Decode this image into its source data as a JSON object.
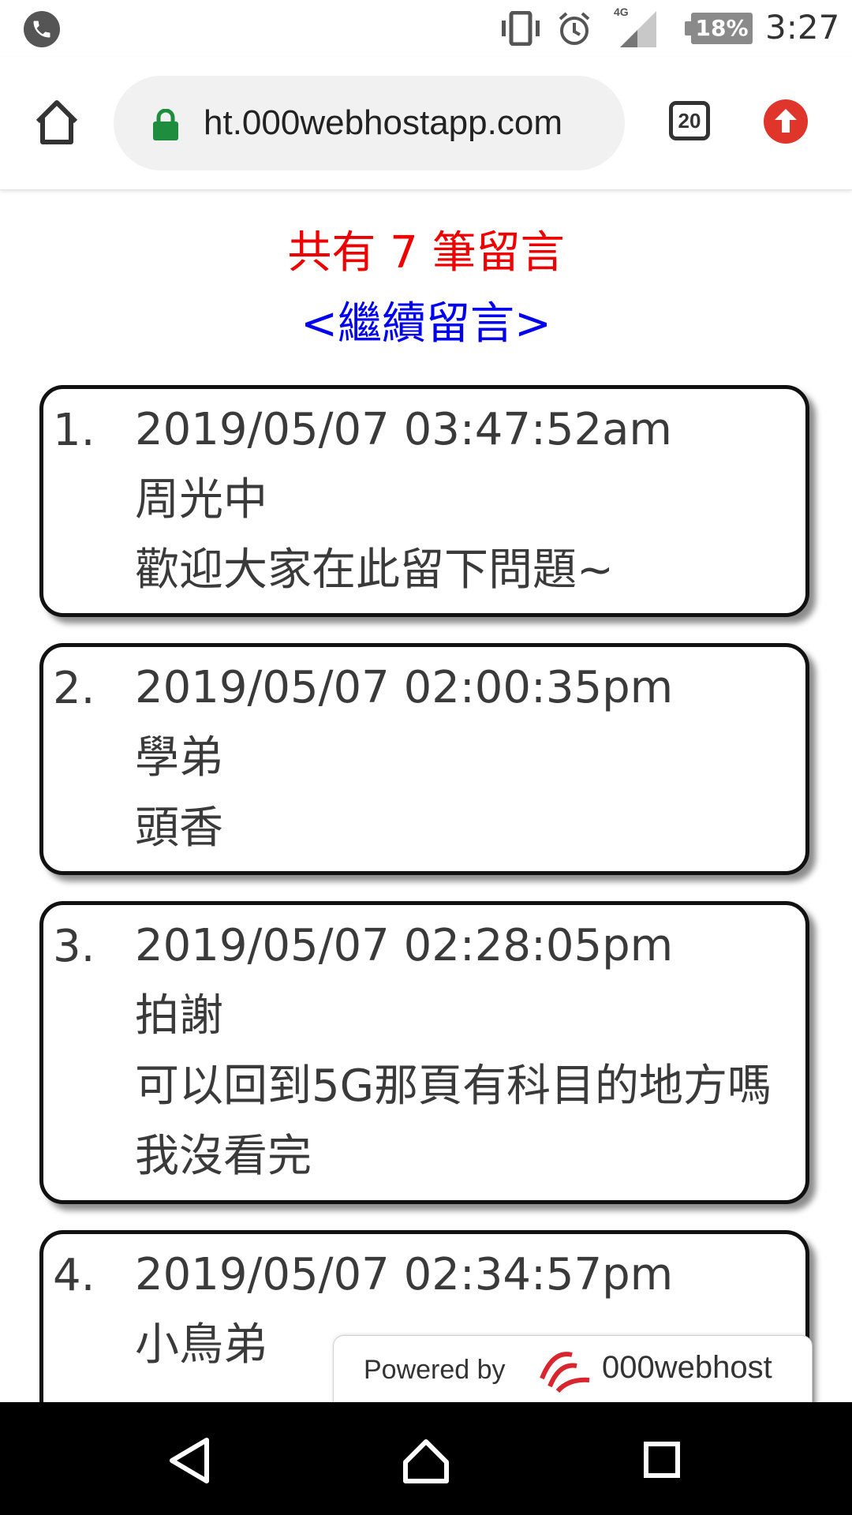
{
  "status_bar": {
    "left_icon": "phone-call-icon",
    "network": "4G",
    "battery": "18%",
    "time": "3:27"
  },
  "browser": {
    "home_icon": "home-icon",
    "url": "ht.000webhostapp.com",
    "lock_icon": "lock-icon",
    "tab_count": "20",
    "update_icon": "arrow-up-icon",
    "accent_red": "#e0352b"
  },
  "page": {
    "count_text": "共有 7 筆留言",
    "continue_link": "<繼續留言>",
    "messages": [
      {
        "num": "1.",
        "time": "2019/05/07 03:47:52am",
        "name": "周光中",
        "body": "歡迎大家在此留下問題~"
      },
      {
        "num": "2.",
        "time": "2019/05/07 02:00:35pm",
        "name": "學弟",
        "body": "頭香"
      },
      {
        "num": "3.",
        "time": "2019/05/07 02:28:05pm",
        "name": "拍謝",
        "body": "可以回到5G那頁有科目的地方嗎 我沒看完"
      },
      {
        "num": "4.",
        "time": "2019/05/07 02:34:57pm",
        "name": "小鳥弟",
        "body": ""
      }
    ]
  },
  "powered_badge": {
    "text": "Powered by",
    "brand": "000webhost"
  },
  "nav": {
    "back_icon": "back-triangle-icon",
    "home_icon": "home-circle-icon",
    "recents_icon": "recents-square-icon"
  }
}
